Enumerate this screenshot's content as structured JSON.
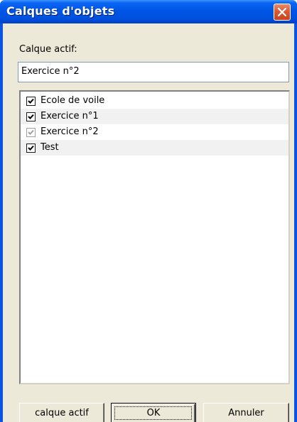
{
  "window": {
    "title": "Calques d'objets"
  },
  "active_layer": {
    "label": "Calque actif:",
    "value": "Exercice n°2"
  },
  "layers": [
    {
      "label": "Ecole de voile",
      "checked": true,
      "enabled": true
    },
    {
      "label": "Exercice n°1",
      "checked": true,
      "enabled": true
    },
    {
      "label": "Exercice n°2",
      "checked": true,
      "enabled": false
    },
    {
      "label": "Test",
      "checked": true,
      "enabled": true
    }
  ],
  "buttons": {
    "set_active": "calque actif",
    "ok": "OK",
    "cancel": "Annuler"
  },
  "icons": {
    "close": "close-icon",
    "checkbox": "checkmark-icon"
  },
  "colors": {
    "titlebar": "#0055e5",
    "close_button": "#dd5a33",
    "dialog_face": "#ece9d8",
    "checkmark": "#000000",
    "checkmark_disabled": "#a0a0a0"
  }
}
